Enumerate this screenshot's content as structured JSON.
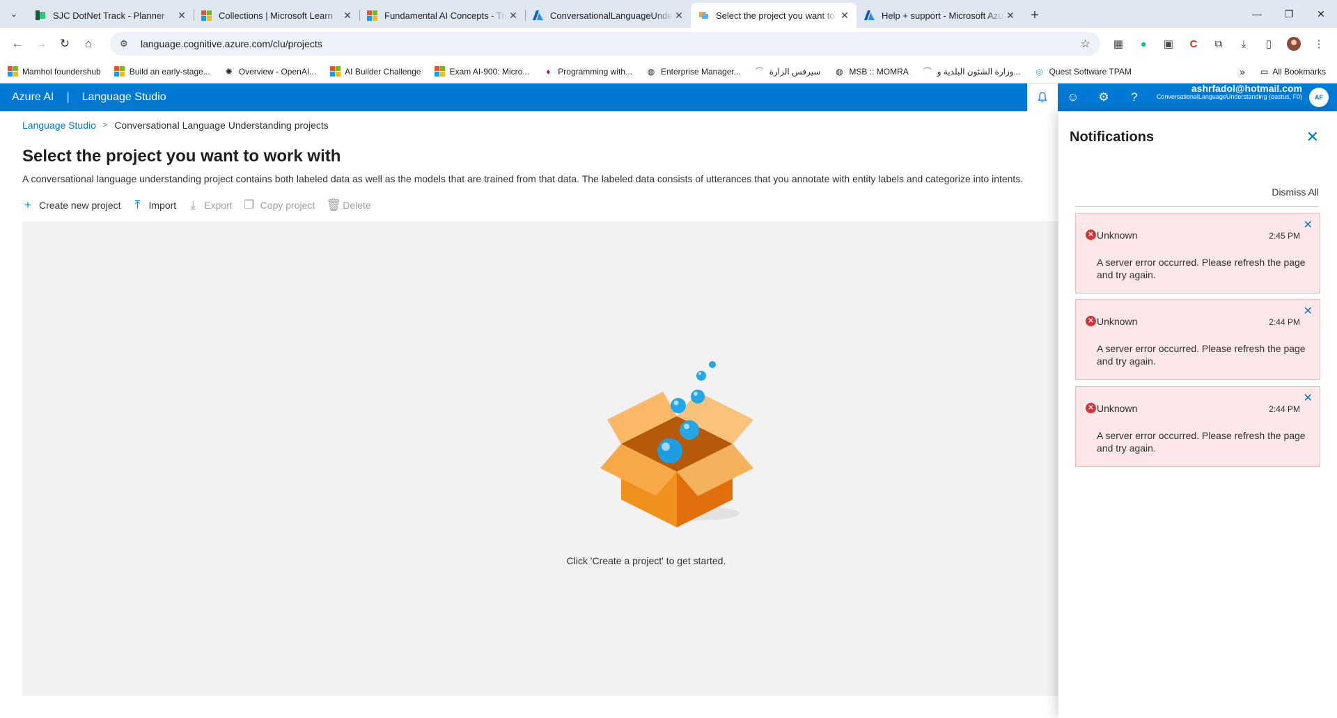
{
  "browser": {
    "tabs": [
      {
        "title": "SJC DotNet Track - Planner",
        "icon": "planner-icon",
        "active": false
      },
      {
        "title": "Collections | Microsoft Learn",
        "icon": "microsoft-logo-icon",
        "active": false
      },
      {
        "title": "Fundamental AI Concepts - Trai",
        "icon": "microsoft-logo-icon",
        "active": false
      },
      {
        "title": "ConversationalLanguageUnder",
        "icon": "azure-icon",
        "active": false
      },
      {
        "title": "Select the project you want to w",
        "icon": "language-studio-icon",
        "active": true
      },
      {
        "title": "Help + support - Microsoft Azu",
        "icon": "azure-icon",
        "active": false
      }
    ],
    "url": "language.cognitive.azure.com/clu/projects",
    "bookmarks": [
      {
        "label": "Mamhol foundershub",
        "icon": "microsoft-logo-icon"
      },
      {
        "label": "Build an early-stage...",
        "icon": "microsoft-logo-icon"
      },
      {
        "label": "Overview - OpenAI...",
        "icon": "openai-icon"
      },
      {
        "label": "AI Builder Challenge",
        "icon": "microsoft-logo-icon"
      },
      {
        "label": "Exam AI-900: Micro...",
        "icon": "microsoft-logo-icon"
      },
      {
        "label": "Programming with...",
        "icon": "gem-icon"
      },
      {
        "label": "Enterprise Manager...",
        "icon": "globe-icon"
      },
      {
        "label": "سيرفس الزارة",
        "icon": "momra-icon"
      },
      {
        "label": "MSB :: MOMRA",
        "icon": "globe-icon"
      },
      {
        "label": "وزارة الشئون البلدية و...",
        "icon": "momra-icon"
      },
      {
        "label": "Quest Software TPAM",
        "icon": "quest-icon"
      }
    ],
    "all_bookmarks_label": "All Bookmarks"
  },
  "appbar": {
    "brand": "Azure AI",
    "separator": "|",
    "product": "Language Studio",
    "email": "ashrfadol@hotmail.com",
    "resource": "ConversationalLanguageUnderstanding (eastus, F0)",
    "avatar_initials": "AF"
  },
  "breadcrumb": {
    "root": "Language Studio",
    "current": "Conversational Language Understanding projects"
  },
  "page": {
    "title": "Select the project you want to work with",
    "description": "A conversational language understanding project contains both labeled data as well as the models that are trained from that data. The labeled data consists of utterances that you annotate with entity labels and categorize into intents.",
    "commands": {
      "create": "Create new project",
      "import": "Import",
      "export": "Export",
      "copy": "Copy project",
      "delete": "Delete"
    },
    "empty_message": "Click 'Create a project' to get started."
  },
  "notifications": {
    "title": "Notifications",
    "dismiss_all": "Dismiss All",
    "items": [
      {
        "type": "Unknown",
        "time": "2:45 PM",
        "message": "A server error occurred. Please refresh the page and try again."
      },
      {
        "type": "Unknown",
        "time": "2:44 PM",
        "message": "A server error occurred. Please refresh the page and try again."
      },
      {
        "type": "Unknown",
        "time": "2:44 PM",
        "message": "A server error occurred. Please refresh the page and try again."
      }
    ]
  },
  "colors": {
    "accent": "#0078d4",
    "error_bg": "#fde7e9",
    "error_icon": "#d13438"
  }
}
